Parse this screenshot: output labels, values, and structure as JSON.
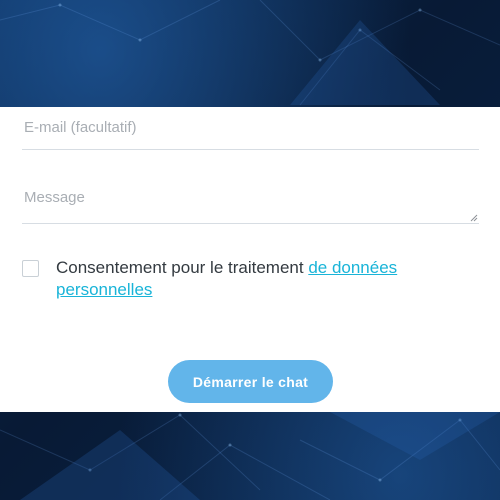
{
  "form": {
    "email": {
      "placeholder": "E-mail (facultatif)",
      "value": ""
    },
    "message": {
      "placeholder": "Message",
      "value": ""
    },
    "consent": {
      "text": "Consentement pour le traitement ",
      "link_text": "de données personnelles",
      "checked": false
    },
    "start_button_label": "Démarrer le chat"
  },
  "colors": {
    "background": "#0a1f3c",
    "panel": "#ffffff",
    "link": "#19b4d8",
    "button": "#62b5ea",
    "button_text": "#ffffff"
  }
}
